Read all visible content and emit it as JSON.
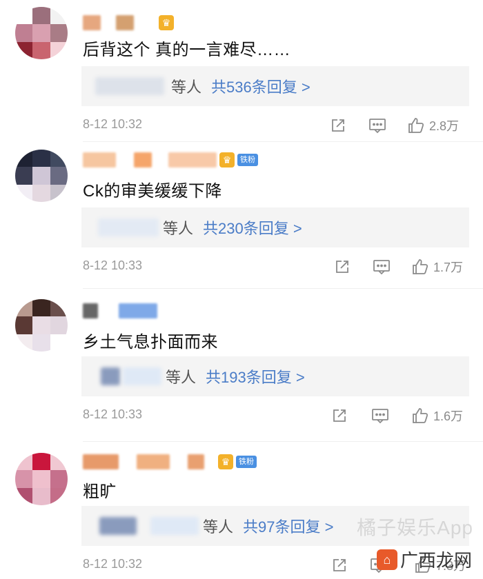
{
  "comments": [
    {
      "text": "后背这个 真的一言难尽……",
      "reply_who": "等人",
      "reply_count": "共536条回复 >",
      "time": "8-12 10:32",
      "likes": "2.8万",
      "avatar_colors": [
        "#ffffff",
        "#9b6f7c",
        "#f2f2f2",
        "#bf7f92",
        "#d9a0b0",
        "#a97c86",
        "#8c2331",
        "#c9646f",
        "#f4d2d8"
      ],
      "name_colors": [
        "#e6a77f",
        "#d4a070"
      ],
      "has_crown": true,
      "has_badge": false
    },
    {
      "text": "Ck的审美缓缓下降",
      "reply_who": "等人",
      "reply_count": "共230条回复 >",
      "time": "8-12 10:33",
      "likes": "1.7万",
      "avatar_colors": [
        "#1e2233",
        "#2a3046",
        "#414a60",
        "#3a3d52",
        "#cfc6d6",
        "#6a6b82",
        "#f2eef5",
        "#e4d8e0",
        "#c7c2cc"
      ],
      "name_colors": [
        "#f6c6a0",
        "#f5a56a",
        "#f8c9a8"
      ],
      "has_crown": true,
      "has_badge": true
    },
    {
      "text": "乡土气息扑面而来",
      "reply_who": "等人",
      "reply_count": "共193条回复 >",
      "time": "8-12 10:33",
      "likes": "1.6万",
      "avatar_colors": [
        "#b89a8f",
        "#3a2520",
        "#6a4f4c",
        "#5a3934",
        "#e9dde5",
        "#e1d6df",
        "#f3ecef",
        "#e8e0ea",
        "#ffffff"
      ],
      "name_colors": [
        "#666666",
        "#7fa9e8"
      ],
      "has_crown": false,
      "has_badge": false
    },
    {
      "text": "粗旷",
      "reply_who": "等人",
      "reply_count": "共97条回复 >",
      "time": "8-12 10:32",
      "likes": "7.3万",
      "avatar_colors": [
        "#efc3cf",
        "#c9163c",
        "#f0c8d2",
        "#d793a9",
        "#efc0cd",
        "#c5708c",
        "#b05070",
        "#e8bccb",
        "#c46d88"
      ],
      "name_colors": [
        "#e79a6a",
        "#f0b080",
        "#e9a070"
      ],
      "has_crown": true,
      "has_badge": true
    }
  ],
  "badge_label": "铁粉",
  "watermark": {
    "text": "橘子娱乐App",
    "site_label": "广西龙网"
  },
  "icons": {
    "share": "share-icon",
    "comment": "comment-icon",
    "like": "thumbs-up-icon"
  }
}
